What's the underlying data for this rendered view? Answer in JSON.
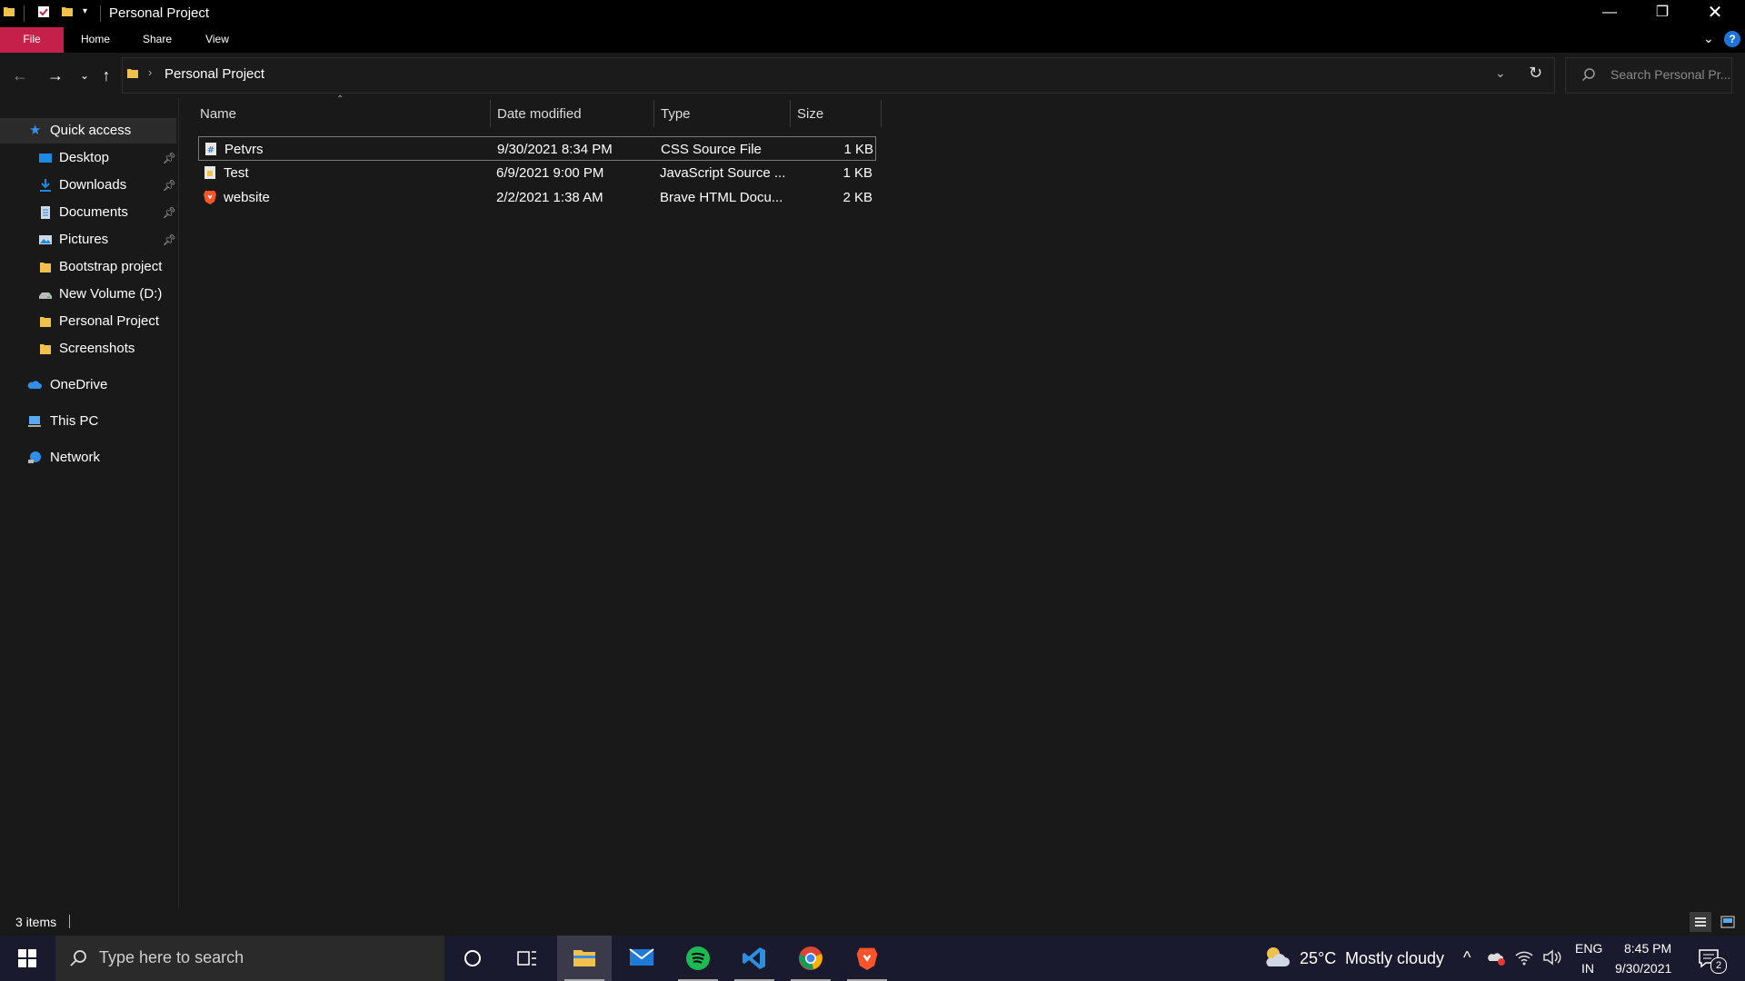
{
  "window": {
    "title": "Personal Project"
  },
  "ribbon": {
    "tabs": [
      "File",
      "Home",
      "Share",
      "View"
    ]
  },
  "address": {
    "path": "Personal Project",
    "search_placeholder": "Search Personal Pr..."
  },
  "sidebar": {
    "quick_access": "Quick access",
    "items": [
      {
        "label": "Desktop",
        "icon": "desktop-icon",
        "pinned": true
      },
      {
        "label": "Downloads",
        "icon": "downloads-icon",
        "pinned": true
      },
      {
        "label": "Documents",
        "icon": "documents-icon",
        "pinned": true
      },
      {
        "label": "Pictures",
        "icon": "pictures-icon",
        "pinned": true
      },
      {
        "label": "Bootstrap project",
        "icon": "folder-icon",
        "pinned": false
      },
      {
        "label": "New Volume (D:)",
        "icon": "drive-icon",
        "pinned": false
      },
      {
        "label": "Personal Project",
        "icon": "folder-icon",
        "pinned": false
      },
      {
        "label": "Screenshots",
        "icon": "folder-icon",
        "pinned": false
      }
    ],
    "onedrive": "OneDrive",
    "this_pc": "This PC",
    "network": "Network"
  },
  "columns": {
    "name": "Name",
    "date": "Date modified",
    "type": "Type",
    "size": "Size"
  },
  "files": [
    {
      "name": "Petvrs",
      "date": "9/30/2021 8:34 PM",
      "type": "CSS Source File",
      "size": "1 KB",
      "icon": "css-file-icon"
    },
    {
      "name": "Test",
      "date": "6/9/2021 9:00 PM",
      "type": "JavaScript Source ...",
      "size": "1 KB",
      "icon": "js-file-icon"
    },
    {
      "name": "website",
      "date": "2/2/2021 1:38 AM",
      "type": "Brave HTML Docu...",
      "size": "2 KB",
      "icon": "brave-html-icon"
    }
  ],
  "status": {
    "count": "3 items"
  },
  "taskbar": {
    "search_placeholder": "Type here to search",
    "weather_temp": "25°C",
    "weather_text": "Mostly cloudy",
    "lang": "ENG",
    "region": "IN",
    "time": "8:45 PM",
    "date": "9/30/2021",
    "notification_count": "2"
  },
  "colors": {
    "accent_file_tab": "#c4204a",
    "folder": "#f0c24b"
  }
}
